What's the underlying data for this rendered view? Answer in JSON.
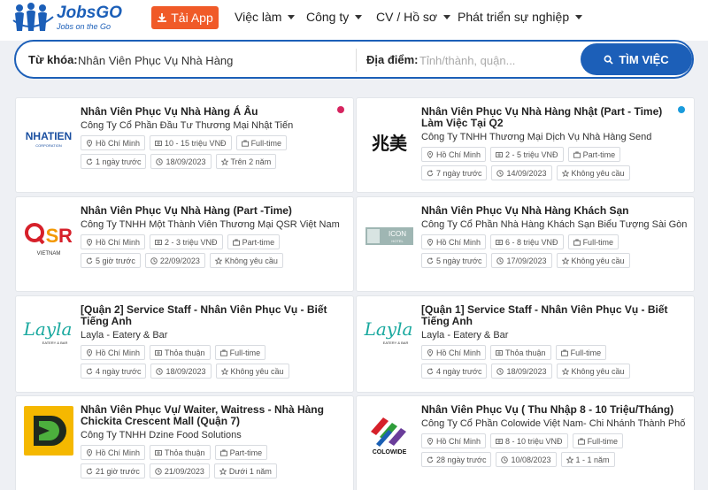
{
  "header": {
    "logo_title": "JobsGO",
    "logo_sub": "Jobs on the Go",
    "app_button": "Tải App",
    "nav": [
      "Việc làm",
      "Công ty",
      "CV / Hồ sơ",
      "Phát triển sự nghiệp"
    ]
  },
  "search": {
    "keyword_label": "Từ khóa:",
    "keyword_value": "Nhân Viên Phục Vụ Nhà Hàng",
    "location_label": "Địa điểm:",
    "location_placeholder": "Tỉnh/thành, quận...",
    "button": "TÌM VIỆC"
  },
  "jobs": [
    {
      "title": "Nhân Viên Phục Vụ Nhà Hàng Á Âu",
      "company": "Công Ty Cổ Phần Đầu Tư Thương Mại Nhật Tiến",
      "location": "Hồ Chí Minh",
      "salary": "10 - 15 triệu VNĐ",
      "type": "Full-time",
      "posted": "1 ngày trước",
      "deadline": "18/09/2023",
      "experience": "Trên 2 năm",
      "dot_color": "#d6245f",
      "logo": "NHATTIEN"
    },
    {
      "title": "Nhân Viên Phục Vụ Nhà Hàng Nhật (Part - Time) Làm Việc Tại Q2",
      "company": "Công Ty TNHH Thương Mại Dịch Vụ Nhà Hàng Send",
      "location": "Hồ Chí Minh",
      "salary": "2 - 5 triệu VNĐ",
      "type": "Part-time",
      "posted": "7 ngày trước",
      "deadline": "14/09/2023",
      "experience": "Không yêu cầu",
      "dot_color": "#1a9bdc",
      "logo": "兆美"
    },
    {
      "title": "Nhân Viên Phục Vụ Nhà Hàng (Part -Time)",
      "company": "Công Ty TNHH Một Thành Viên Thương Mại QSR Việt Nam",
      "location": "Hồ Chí Minh",
      "salary": "2 - 3 triệu VNĐ",
      "type": "Part-time",
      "posted": "5 giờ trước",
      "deadline": "22/09/2023",
      "experience": "Không yêu cầu",
      "logo": "QSR"
    },
    {
      "title": "Nhân Viên Phục Vụ Nhà Hàng Khách Sạn",
      "company": "Công Ty Cổ Phần Nhà Hàng Khách Sạn Biểu Tượng Sài Gòn",
      "location": "Hồ Chí Minh",
      "salary": "6 - 8 triệu VNĐ",
      "type": "Full-time",
      "posted": "5 ngày trước",
      "deadline": "17/09/2023",
      "experience": "Không yêu cầu",
      "logo": "ICON"
    },
    {
      "title": "[Quận 2] Service Staff - Nhân Viên Phục Vụ - Biết Tiếng Anh",
      "company": "Layla - Eatery & Bar",
      "location": "Hồ Chí Minh",
      "salary": "Thỏa thuận",
      "type": "Full-time",
      "posted": "4 ngày trước",
      "deadline": "18/09/2023",
      "experience": "Không yêu cầu",
      "logo": "Layla"
    },
    {
      "title": "[Quận 1] Service Staff - Nhân Viên Phục Vụ - Biết Tiếng Anh",
      "company": "Layla - Eatery & Bar",
      "location": "Hồ Chí Minh",
      "salary": "Thỏa thuận",
      "type": "Full-time",
      "posted": "4 ngày trước",
      "deadline": "18/09/2023",
      "experience": "Không yêu cầu",
      "logo": "Layla"
    },
    {
      "title": "Nhân Viên Phục Vụ/ Waiter, Waitress - Nhà Hàng Chickita Crescent Mall (Quận 7)",
      "company": "Công Ty TNHH Dzine Food Solutions",
      "location": "Hồ Chí Minh",
      "salary": "Thỏa thuận",
      "type": "Part-time",
      "posted": "21 giờ trước",
      "deadline": "21/09/2023",
      "experience": "Dưới 1 năm",
      "logo": "D"
    },
    {
      "title": "Nhân Viên Phục Vụ ( Thu Nhập 8 - 10 Triệu/Tháng)",
      "company": "Công Ty Cổ Phần Colowide Việt Nam- Chi Nhánh Thành Phố ...",
      "location": "Hồ Chí Minh",
      "salary": "8 - 10 triệu VNĐ",
      "type": "Full-time",
      "posted": "28 ngày trước",
      "deadline": "10/08/2023",
      "experience": "1 - 1 năm",
      "logo": "COLOWIDE"
    }
  ]
}
